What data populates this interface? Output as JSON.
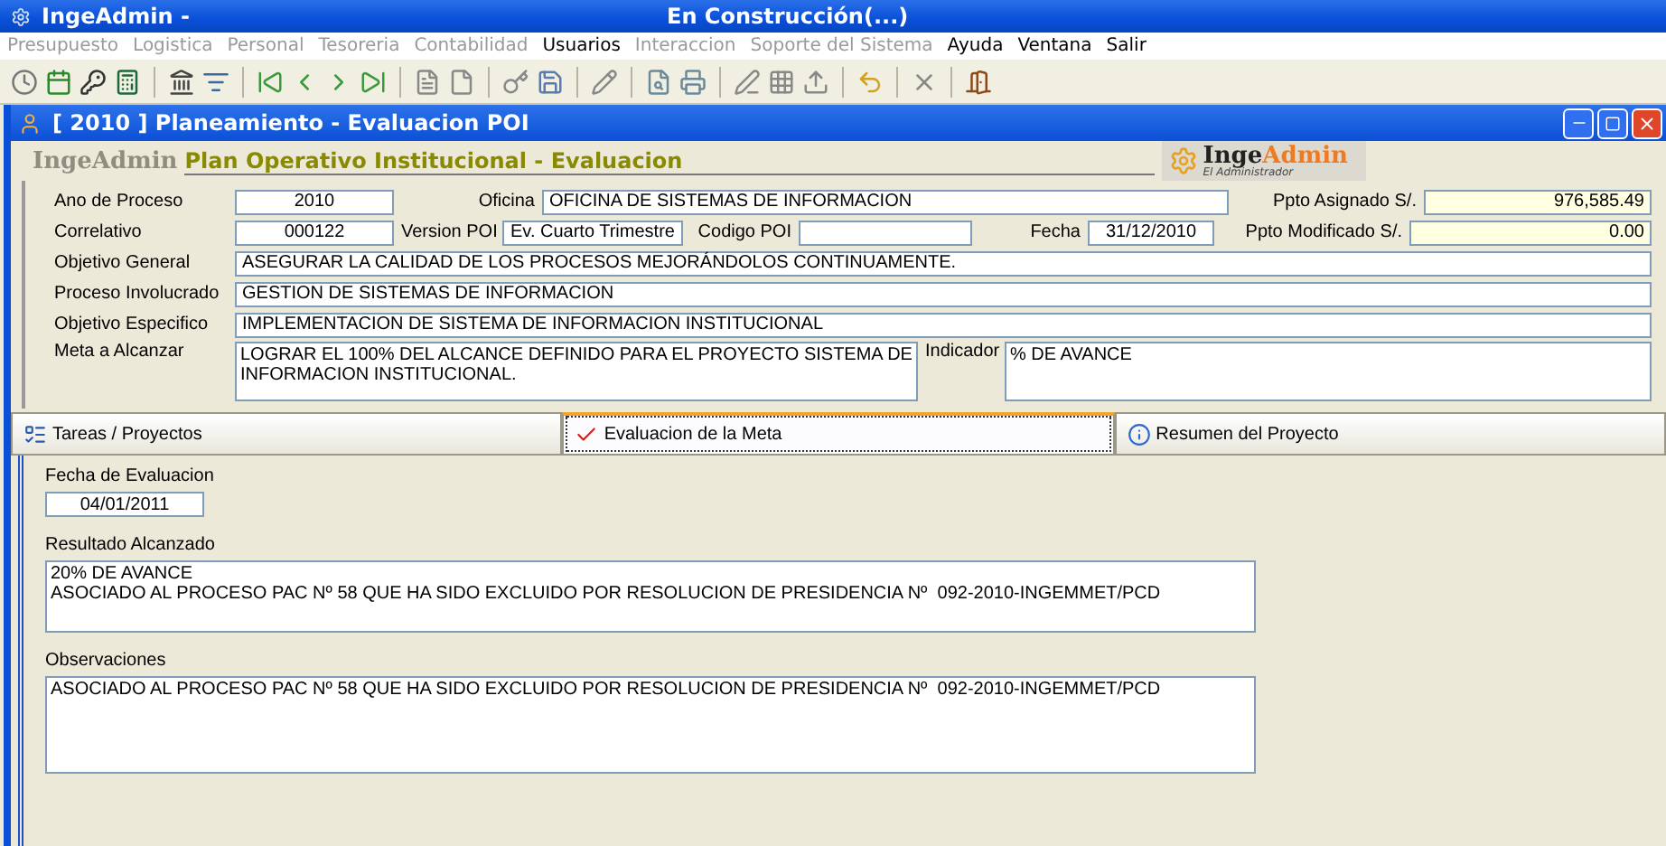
{
  "app_window": {
    "title": "IngeAdmin -",
    "subtitle": "En Construcción(...)"
  },
  "menu": [
    {
      "label": "Presupuesto",
      "disabled": true
    },
    {
      "label": "Logistica",
      "disabled": true
    },
    {
      "label": "Personal",
      "disabled": true
    },
    {
      "label": "Tesoreria",
      "disabled": true
    },
    {
      "label": "Contabilidad",
      "disabled": true
    },
    {
      "label": "Usuarios",
      "disabled": false
    },
    {
      "label": "Interaccion",
      "disabled": true
    },
    {
      "label": "Soporte del Sistema",
      "disabled": true
    },
    {
      "label": "Ayuda",
      "disabled": false
    },
    {
      "label": "Ventana",
      "disabled": false
    },
    {
      "label": "Salir",
      "disabled": false
    }
  ],
  "child_window": {
    "title": "[ 2010 ] Planeamiento - Evaluacion POI"
  },
  "header": {
    "brand_faded": "IngeAdmin",
    "title": "Plan Operativo Institucional - Evaluacion",
    "logo_left": "Inge",
    "logo_right": "Admin",
    "logo_tagline": "El Administrador"
  },
  "form": {
    "ano_de_proceso": {
      "label": "Ano de Proceso",
      "value": "2010"
    },
    "oficina": {
      "label": "Oficina",
      "value": "OFICINA DE SISTEMAS DE INFORMACION"
    },
    "ppto_asignado": {
      "label": "Ppto Asignado S/.",
      "value": "976,585.49"
    },
    "correlativo": {
      "label": "Correlativo",
      "value": "000122"
    },
    "version_poi": {
      "label": "Version POI",
      "value": "Ev. Cuarto Trimestre"
    },
    "codigo_poi": {
      "label": "Codigo POI"
    },
    "fecha": {
      "label": "Fecha",
      "value": "31/12/2010"
    },
    "ppto_modificado": {
      "label": "Ppto Modificado S/.",
      "value": "0.00"
    },
    "wide_rows": [
      {
        "label": "Objetivo General",
        "value": "ASEGURAR LA CALIDAD DE LOS PROCESOS MEJORÁNDOLOS CONTINUAMENTE."
      },
      {
        "label": "Proceso Involucrado",
        "value": "GESTION DE SISTEMAS DE INFORMACION"
      },
      {
        "label": "Objetivo Especifico",
        "value": "IMPLEMENTACION DE SISTEMA DE INFORMACION INSTITUCIONAL"
      }
    ],
    "meta": {
      "label": "Meta a Alcanzar",
      "value": "LOGRAR EL 100% DEL ALCANCE DEFINIDO PARA EL PROYECTO SISTEMA DE INFORMACION INSTITUCIONAL."
    },
    "indicador": {
      "label": "Indicador",
      "value": "% DE AVANCE"
    }
  },
  "tabs": [
    {
      "label": "Tareas / Proyectos",
      "kind": "tasks",
      "selected": false
    },
    {
      "label": "Evaluacion de la Meta",
      "kind": "check",
      "selected": true
    },
    {
      "label": "Resumen del Proyecto",
      "kind": "info",
      "selected": false
    }
  ],
  "evaluation": {
    "fecha": {
      "label": "Fecha de Evaluacion",
      "value": "04/01/2011"
    },
    "resultado": {
      "label": "Resultado Alcanzado",
      "value": "20% DE AVANCE\nASOCIADO AL PROCESO PAC Nº 58 QUE HA SIDO EXCLUIDO POR RESOLUCION DE PRESIDENCIA Nº  092-2010-INGEMMET/PCD"
    },
    "observaciones": {
      "label": "Observaciones",
      "value": "ASOCIADO AL PROCESO PAC Nº 58 QUE HA SIDO EXCLUIDO POR RESOLUCION DE PRESIDENCIA Nº  092-2010-INGEMMET/PCD"
    }
  }
}
